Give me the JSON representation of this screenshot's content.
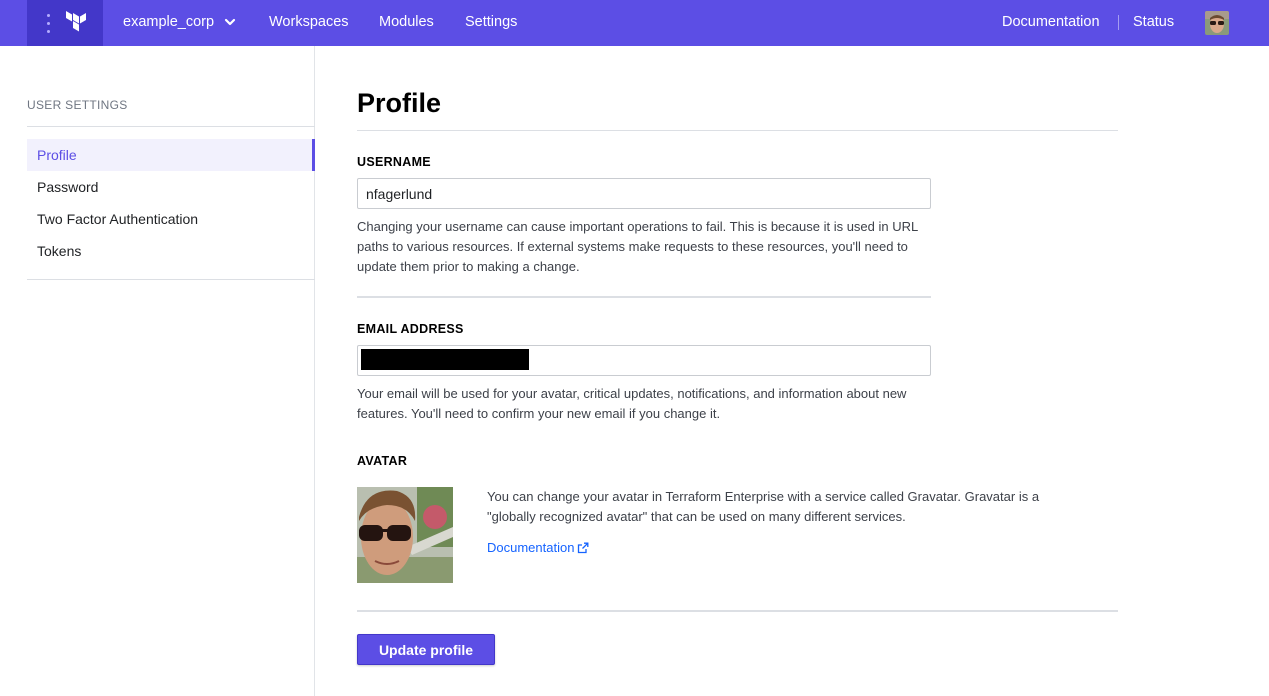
{
  "nav": {
    "org_name": "example_corp",
    "links": [
      "Workspaces",
      "Modules",
      "Settings"
    ],
    "right_links": [
      "Documentation",
      "Status"
    ],
    "brand_color": "#5c4ee5"
  },
  "sidebar": {
    "heading": "USER SETTINGS",
    "items": [
      {
        "label": "Profile",
        "active": true
      },
      {
        "label": "Password"
      },
      {
        "label": "Two Factor Authentication"
      },
      {
        "label": "Tokens"
      }
    ]
  },
  "main": {
    "title": "Profile",
    "username": {
      "label": "USERNAME",
      "value": "nfagerlund",
      "help": "Changing your username can cause important operations to fail. This is because it is used in URL paths to various resources. If external systems make requests to these resources, you'll need to update them prior to making a change."
    },
    "email": {
      "label": "EMAIL ADDRESS",
      "value": "",
      "help": "Your email will be used for your avatar, critical updates, notifications, and information about new features. You'll need to confirm your new email if you change it."
    },
    "avatar": {
      "label": "AVATAR",
      "text": "You can change your avatar in Terraform Enterprise with a service called Gravatar. Gravatar is a \"globally recognized avatar\" that can be used on many different services.",
      "link": "Documentation"
    },
    "submit_label": "Update profile"
  }
}
